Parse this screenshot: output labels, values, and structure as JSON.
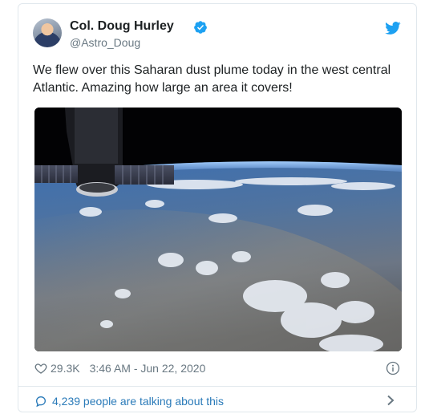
{
  "user": {
    "name": "Col. Doug Hurley",
    "handle": "@Astro_Doug"
  },
  "tweet": {
    "text": "We flew over this Saharan dust plume today in the west central Atlantic.  Amazing how large an area it covers!",
    "likes": "29.3K",
    "timestamp": "3:46 AM - Jun 22, 2020"
  },
  "conversation": {
    "label": "4,239 people are talking about this"
  },
  "icons": {
    "verified": "verified-badge-icon",
    "brand": "twitter-bird-icon",
    "like": "heart-icon",
    "info": "info-icon",
    "reply": "speech-bubble-icon",
    "more": "chevron-right-icon"
  },
  "colors": {
    "brand_blue": "#1da1f2",
    "link_blue": "#2b7bb9",
    "muted_text": "#697882",
    "border": "#e1e8ed"
  }
}
